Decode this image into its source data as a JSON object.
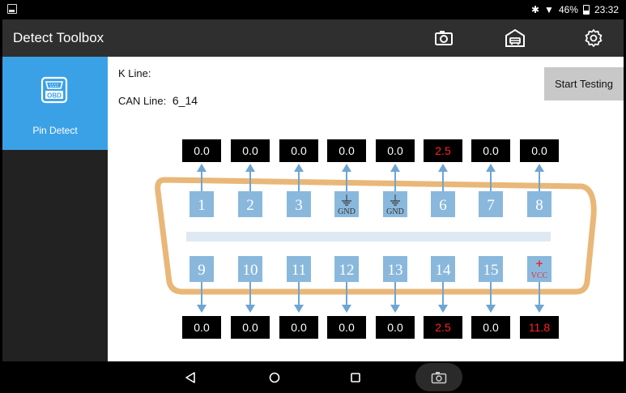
{
  "status_bar": {
    "battery": "46%",
    "time": "23:32"
  },
  "app_bar": {
    "title": "Detect Toolbox",
    "actions": [
      "camera-icon",
      "garage-icon",
      "settings-icon"
    ]
  },
  "sidebar": {
    "items": [
      {
        "label": "Pin Detect",
        "icon": "obd-icon",
        "icon_text": "OBD",
        "active": true
      }
    ]
  },
  "main": {
    "k_line_label": "K Line:",
    "k_line_value": "",
    "can_line_label": "CAN Line:",
    "can_line_value": "6_14",
    "start_button": "Start Testing"
  },
  "pins": {
    "top": [
      {
        "label": "1",
        "value": "0.0",
        "alert": false
      },
      {
        "label": "2",
        "value": "0.0",
        "alert": false
      },
      {
        "label": "3",
        "value": "0.0",
        "alert": false
      },
      {
        "label": "GND",
        "value": "0.0",
        "alert": false,
        "ground": true
      },
      {
        "label": "GND",
        "value": "0.0",
        "alert": false,
        "ground": true
      },
      {
        "label": "6",
        "value": "2.5",
        "alert": true
      },
      {
        "label": "7",
        "value": "0.0",
        "alert": false
      },
      {
        "label": "8",
        "value": "0.0",
        "alert": false
      }
    ],
    "bottom": [
      {
        "label": "9",
        "value": "0.0",
        "alert": false
      },
      {
        "label": "10",
        "value": "0.0",
        "alert": false
      },
      {
        "label": "11",
        "value": "0.0",
        "alert": false
      },
      {
        "label": "12",
        "value": "0.0",
        "alert": false
      },
      {
        "label": "13",
        "value": "0.0",
        "alert": false
      },
      {
        "label": "14",
        "value": "2.5",
        "alert": true
      },
      {
        "label": "15",
        "value": "0.0",
        "alert": false
      },
      {
        "label": "VCC",
        "value": "11.8",
        "alert": true,
        "vcc": true,
        "sign": "+"
      }
    ]
  },
  "colors": {
    "accent": "#3ba1e6",
    "pin_fill": "#8ab8dc",
    "arrow": "#6ea5d3",
    "connector_outline": "#e9b778",
    "alert_text": "#ff2020",
    "vcc_text": "#e0303a"
  },
  "nav_bar": {
    "buttons": [
      "back-icon",
      "home-icon",
      "recents-icon",
      "screenshot-icon"
    ]
  }
}
